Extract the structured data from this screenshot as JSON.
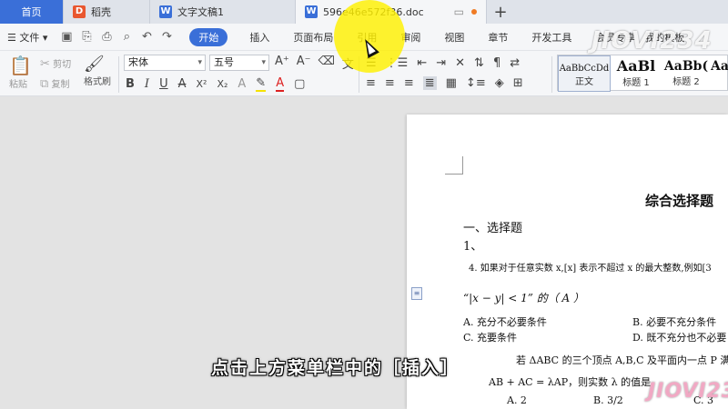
{
  "tabs": [
    {
      "label": "首页"
    },
    {
      "label": "稻壳"
    },
    {
      "label": "文字文稿1"
    },
    {
      "label": "596e46e572f36.doc"
    }
  ],
  "tab_add": "+",
  "menubar": {
    "file": "文件",
    "items": [
      "开始",
      "插入",
      "页面布局",
      "引用",
      "审阅",
      "视图",
      "章节",
      "开发工具",
      "会员专享"
    ],
    "extra_right": "我的模板"
  },
  "ribbon": {
    "cut": "剪切",
    "copy": "复制",
    "paste": "粘贴",
    "format_painter": "格式刷",
    "font_name": "宋体",
    "font_size": "五号",
    "bold": "B",
    "italic": "I",
    "underline": "U",
    "strike": "A",
    "superscript": "X²",
    "subscript": "X₂",
    "styles": [
      {
        "preview": "AaBbCcDd",
        "name": "正文"
      },
      {
        "preview": "AaBl",
        "name": "标题 1"
      },
      {
        "preview": "AaBb(",
        "name": "标题 2"
      },
      {
        "preview": "Aa",
        "name": ""
      }
    ]
  },
  "document": {
    "title": "综合选择题",
    "section": "一、选择题",
    "item_number": "1、",
    "q4": "4. 如果对于任意实数 x,[x] 表示不超过 x 的最大整数,例如[3",
    "condition": "“|x − y| < 1” 的（  A  ）",
    "options": [
      "A. 充分不必要条件",
      "B. 必要不充分条件",
      "C. 充要条件",
      "D. 既不充分也不必要"
    ],
    "q5_part1": "若 ΔABC 的三个顶点 A,B,C 及平面内一点 P 满足",
    "q5_part2": "AB + AC = λAP，则实数 λ 的值是",
    "q5_options": [
      "A.  2",
      "B.  3/2",
      "C.  3"
    ]
  },
  "subtitle": "点击上方菜单栏中的［插入］",
  "watermark": "JIOVI234"
}
